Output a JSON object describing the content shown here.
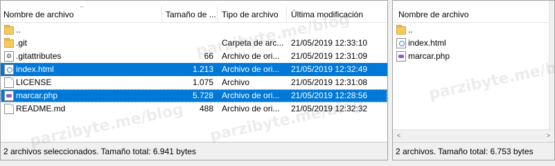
{
  "local": {
    "columns": [
      "Nombre de archivo",
      "Tamaño de ...",
      "Tipo de archivo",
      "Última modificación"
    ],
    "sort_arrow": "^",
    "rows": [
      {
        "name": "..",
        "size": "",
        "type": "",
        "modified": "",
        "icon": "folder-icon",
        "selected": false
      },
      {
        "name": ".git",
        "size": "",
        "type": "Carpeta de arc...",
        "modified": "21/05/2019 12:33:10",
        "icon": "folder-icon",
        "selected": false
      },
      {
        "name": ".gitattributes",
        "size": "66",
        "type": "Archivo de ori...",
        "modified": "21/05/2019 12:31:09",
        "icon": "gear-file-icon",
        "selected": false
      },
      {
        "name": "index.html",
        "size": "1.213",
        "type": "Archivo de ori...",
        "modified": "21/05/2019 12:32:49",
        "icon": "html-file-icon",
        "selected": true
      },
      {
        "name": "LICENSE",
        "size": "1.075",
        "type": "Archivo",
        "modified": "21/05/2019 12:31:08",
        "icon": "file-icon",
        "selected": false
      },
      {
        "name": "marcar.php",
        "size": "5.728",
        "type": "Archivo de ori...",
        "modified": "21/05/2019 12:28:56",
        "icon": "php-file-icon",
        "selected": true
      },
      {
        "name": "README.md",
        "size": "488",
        "type": "Archivo de ori...",
        "modified": "21/05/2019 12:32:32",
        "icon": "file-icon",
        "selected": false
      }
    ],
    "status": "2 archivos seleccionados. Tamaño total: 6.941 bytes"
  },
  "remote": {
    "columns": [
      "Nombre de archivo"
    ],
    "rows": [
      {
        "name": "..",
        "icon": "folder-icon"
      },
      {
        "name": "index.html",
        "icon": "html-file-icon"
      },
      {
        "name": "marcar.php",
        "icon": "php-file-icon"
      }
    ],
    "status": "2 archivos. Tamaño total: 6.753 bytes",
    "hscroll_left": "<",
    "hscroll_right": ">"
  },
  "watermark": "parzibyte.me/blog",
  "colors": {
    "selection": "#0078d7",
    "folder": "#f4c95d"
  }
}
